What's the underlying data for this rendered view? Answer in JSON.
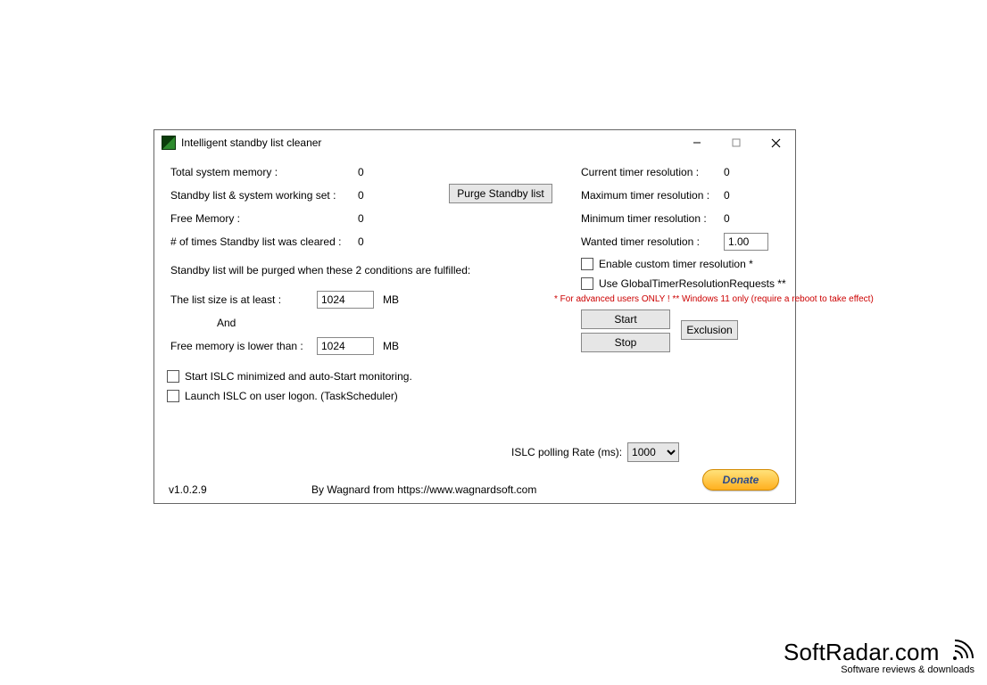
{
  "window": {
    "title": "Intelligent standby list cleaner"
  },
  "stats": {
    "total_memory_label": "Total system memory :",
    "total_memory_value": "0",
    "standby_set_label": "Standby list & system working set :",
    "standby_set_value": "0",
    "free_memory_label": "Free Memory :",
    "free_memory_value": "0",
    "cleared_count_label": "# of times Standby list was cleared :",
    "cleared_count_value": "0"
  },
  "purge_button": "Purge Standby list",
  "conditions": {
    "intro": "Standby list will be purged when these 2 conditions are fulfilled:",
    "list_size_label": "The list size is at least :",
    "list_size_value": "1024",
    "list_size_unit": "MB",
    "and": "And",
    "free_mem_label": "Free memory is lower than :",
    "free_mem_value": "1024",
    "free_mem_unit": "MB"
  },
  "options": {
    "start_minimized": "Start ISLC minimized and auto-Start monitoring.",
    "launch_on_logon": "Launch ISLC on user logon. (TaskScheduler)"
  },
  "timer": {
    "current_label": "Current timer resolution :",
    "current_value": "0",
    "max_label": "Maximum timer resolution :",
    "max_value": "0",
    "min_label": "Minimum timer resolution :",
    "min_value": "0",
    "wanted_label": "Wanted timer resolution :",
    "wanted_value": "1.00",
    "enable_custom": "Enable custom timer resolution *",
    "use_global": "Use GlobalTimerResolutionRequests **",
    "warning": "* For advanced users ONLY !  ** Windows 11 only (require a reboot to take effect)"
  },
  "buttons": {
    "start": "Start",
    "stop": "Stop",
    "exclusion": "Exclusion",
    "donate": "Donate"
  },
  "polling": {
    "label": "ISLC polling Rate (ms):",
    "value": "1000"
  },
  "footer": {
    "version": "v1.0.2.9",
    "byline": "By Wagnard from https://www.wagnardsoft.com"
  },
  "watermark": {
    "brand": "SoftRadar.com",
    "sub": "Software reviews & downloads"
  }
}
